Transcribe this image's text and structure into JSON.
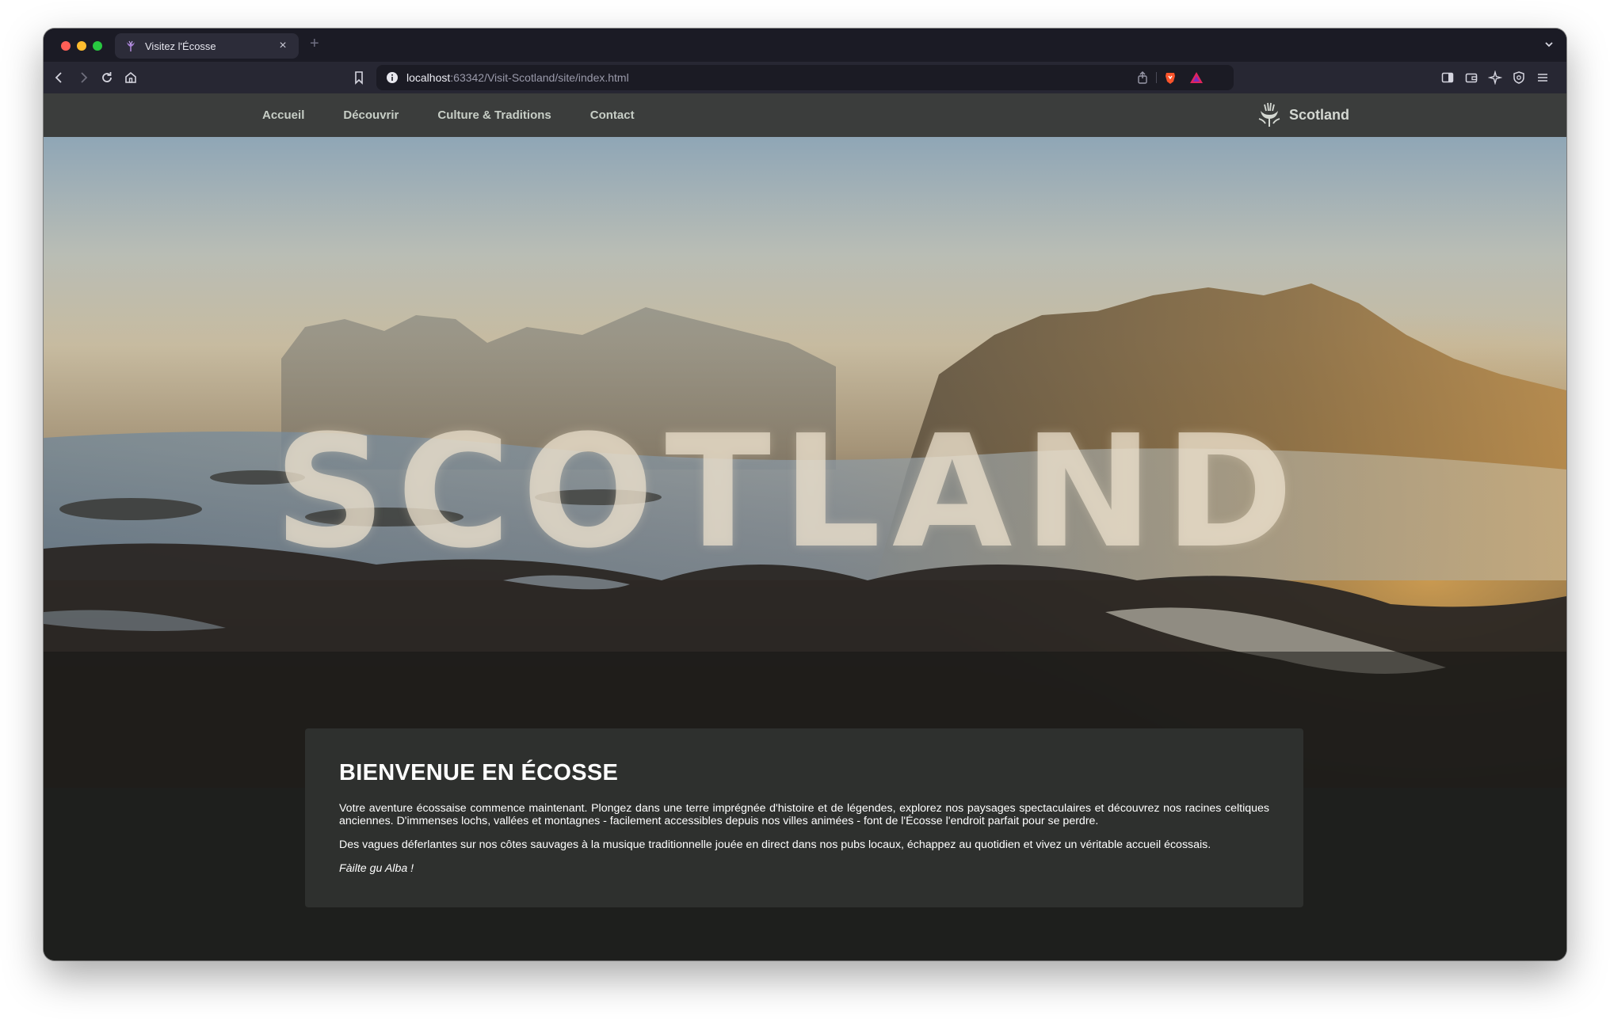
{
  "browser": {
    "tab_title": "Visitez l'Écosse",
    "tab_close": "×",
    "new_tab": "+",
    "url_host": "localhost",
    "url_rest": ":63342/Visit-Scotland/site/index.html"
  },
  "nav": {
    "links": [
      "Accueil",
      "Découvrir",
      "Culture & Traditions",
      "Contact"
    ],
    "brand": "Scotland"
  },
  "hero": {
    "word": "SCOTLAND"
  },
  "welcome": {
    "title": "BIENVENUE EN ÉCOSSE",
    "paragraph1": "Votre aventure écossaise commence maintenant. Plongez dans une terre imprégnée d'histoire et de légendes, explorez nos paysages spectaculaires et découvrez nos racines celtiques anciennes. D'immenses lochs, vallées et montagnes - facilement accessibles depuis nos villes animées - font de l'Écosse l'endroit parfait pour se perdre.",
    "paragraph2": "Des vagues déferlantes sur nos côtes sauvages à la musique traditionnelle jouée en direct dans nos pubs locaux, échappez au quotidien et vivez un véritable accueil écossais.",
    "greeting": "Fàilte gu Alba !"
  },
  "colors": {
    "tab_strip": "#1b1b25",
    "toolbar": "#272733",
    "navbar": "#3b3d3c",
    "page_bg": "#1e1f1d",
    "card_bg": "#2e302e",
    "brave_orange": "#fb542b"
  }
}
